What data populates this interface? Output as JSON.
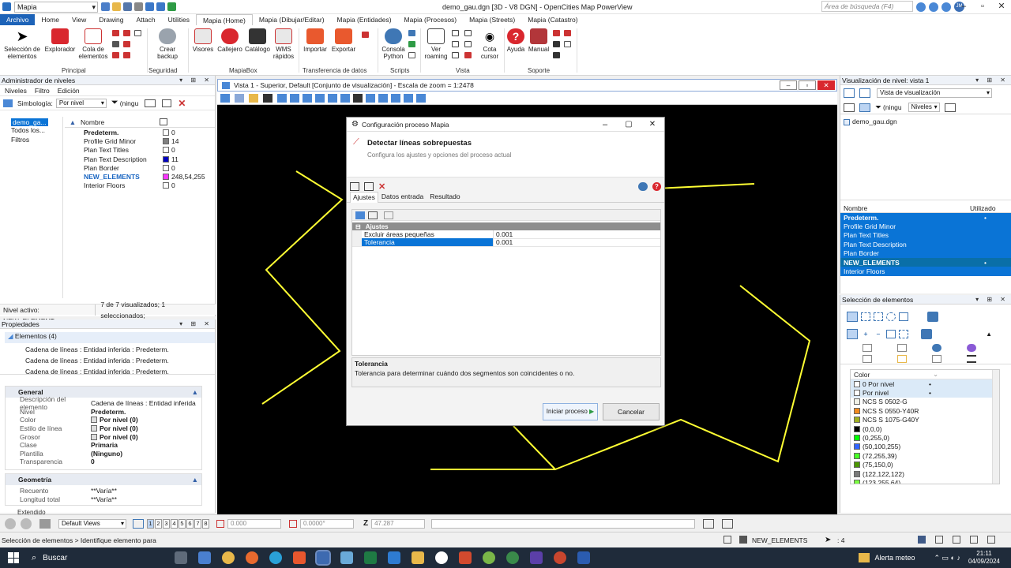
{
  "titlebar": {
    "workspace": "Mapia",
    "title": "demo_gau.dgn [3D - V8 DGN] - OpenCities Map PowerView",
    "search_placeholder": "Área de búsqueda (F4)",
    "user": "JM"
  },
  "tabs": [
    "Archivo",
    "Home",
    "View",
    "Drawing",
    "Attach",
    "Utilities",
    "Mapia (Home)",
    "Mapia (Dibujar/Editar)",
    "Mapia (Entidades)",
    "Mapia (Procesos)",
    "Mapia (Streets)",
    "Mapia (Catastro)"
  ],
  "ribbon": {
    "buttons": {
      "seleccion": "Selección de elementos",
      "explorador": "Explorador",
      "cola": "Cola de elementos",
      "crear_backup": "Crear backup",
      "visores": "Visores",
      "callejero": "Callejero",
      "catalogo": "Catálogo",
      "wms": "WMS rápidos",
      "importar": "Importar",
      "exportar": "Exportar",
      "consola": "Consola Python",
      "ver_roaming": "Ver roaming",
      "cota_cursor": "Cota cursor",
      "ayuda": "Ayuda",
      "manual": "Manual"
    },
    "groups": {
      "principal": "Principal",
      "seguridad": "Seguridad",
      "mapiabox": "MapiaBox",
      "transferencia": "Transferencia de datos",
      "scripts": "Scripts",
      "vista": "Vista",
      "soporte": "Soporte"
    }
  },
  "level_manager": {
    "title": "Administrador de niveles",
    "menu": [
      "Niveles",
      "Filtro",
      "Edición"
    ],
    "symbology_label": "Simbología:",
    "symbology_value": "Por nivel",
    "filter_value": "(ningu",
    "tree": [
      "demo_ga...",
      "Todos los...",
      "Filtros"
    ],
    "col_name": "Nombre",
    "levels": [
      {
        "name": "Predeterm.",
        "val": "0",
        "color": "#ffffff",
        "bold": true
      },
      {
        "name": "Profile Grid Minor",
        "val": "14",
        "color": "#808080",
        "bold": false
      },
      {
        "name": "Plan Text Titles",
        "val": "0",
        "color": "#ffffff",
        "bold": false
      },
      {
        "name": "Plan Text Description",
        "val": "11",
        "color": "#0000c0",
        "bold": false
      },
      {
        "name": "Plan Border",
        "val": "0",
        "color": "#ffffff",
        "bold": false
      },
      {
        "name": "NEW_ELEMENTS",
        "val": "248,54,255",
        "color": "#f836ff",
        "bold": true,
        "accent": true
      },
      {
        "name": "Interior Floors",
        "val": "0",
        "color": "#ffffff",
        "bold": false
      }
    ],
    "status_active": "Nivel activo: NEW_ELEMENT",
    "status_count": "7 de 7 visualizados; 1 seleccionados;"
  },
  "properties": {
    "title": "Propiedades",
    "tree_root": "Elementos (4)",
    "tree_items": [
      "Cadena de líneas : Entidad inferida : Predeterm.",
      "Cadena de líneas : Entidad inferida : Predeterm.",
      "Cadena de líneas : Entidad inferida : Predeterm."
    ],
    "general_title": "General",
    "general_rows": [
      {
        "k": "Descripción del elemento",
        "v": "Cadena de líneas : Entidad inferida"
      },
      {
        "k": "Nivel",
        "v": "Predeterm."
      },
      {
        "k": "Color",
        "v": "Por nivel (0)"
      },
      {
        "k": "Estilo de línea",
        "v": "Por nivel (0)"
      },
      {
        "k": "Grosor",
        "v": "Por nivel (0)"
      },
      {
        "k": "Clase",
        "v": "Primaria"
      },
      {
        "k": "Plantilla",
        "v": "(Ninguno)"
      },
      {
        "k": "Transparencia",
        "v": "0"
      }
    ],
    "geometry_title": "Geometría",
    "geometry_rows": [
      {
        "k": "Recuento",
        "v": "**Varía**"
      },
      {
        "k": "Longitud total",
        "v": "**Varía**"
      }
    ],
    "extended_title": "Extendido"
  },
  "view": {
    "title": "Vista 1 - Superior, Default [Conjunto de visualización] - Escala de zoom = 1:2478"
  },
  "dialog": {
    "title": "Configuración proceso Mapia",
    "heading": "Detectar líneas sobrepuestas",
    "subheading": "Configura los ajustes y opciones del proceso actual",
    "tabs": [
      "Ajustes",
      "Datos entrada",
      "Resultado"
    ],
    "group": "Ajustes",
    "props": [
      {
        "k": "Excluir áreas pequeñas",
        "v": "0.001",
        "selected": false
      },
      {
        "k": "Tolerancia",
        "v": "0.001",
        "selected": true
      }
    ],
    "help_title": "Tolerancia",
    "help_text": "Tolerancia para determinar cuándo dos segmentos son coincidentes o no.",
    "start_button": "Iniciar proceso",
    "cancel_button": "Cancelar"
  },
  "level_display": {
    "title": "Visualización de nivel: vista 1",
    "mode": "Vista de visualización",
    "filter_value": "(ningu",
    "levels_dropdown": "Niveles",
    "file": "demo_gau.dgn",
    "col_name": "Nombre",
    "col_used": "Utilizado",
    "levels": [
      {
        "name": "Predeterm.",
        "used": "•",
        "bold": true
      },
      {
        "name": "Profile Grid Minor",
        "used": "",
        "bold": false
      },
      {
        "name": "Plan Text Titles",
        "used": "",
        "bold": false
      },
      {
        "name": "Plan Text Description",
        "used": "",
        "bold": false
      },
      {
        "name": "Plan Border",
        "used": "",
        "bold": false
      },
      {
        "name": "NEW_ELEMENTS",
        "used": "•",
        "bold": true
      },
      {
        "name": "Interior Floors",
        "used": "",
        "bold": false
      }
    ]
  },
  "element_selection": {
    "title": "Selección de elementos",
    "color_header": "Color",
    "colors": [
      {
        "name": "0 Por nivel",
        "dot": "•",
        "color": "#ffffff",
        "hl": true
      },
      {
        "name": "Por nivel",
        "dot": "•",
        "color": "#ffffff",
        "hl": true
      },
      {
        "name": "NCS S 0502-G",
        "dot": "",
        "color": "#f2f2e8",
        "hl": false
      },
      {
        "name": "NCS S 0550-Y40R",
        "dot": "",
        "color": "#f28a1e",
        "hl": false
      },
      {
        "name": "NCS S 1075-G40Y",
        "dot": "",
        "color": "#a0b020",
        "hl": false
      },
      {
        "name": "(0,0,0)",
        "dot": "",
        "color": "#000000",
        "hl": false
      },
      {
        "name": "(0,255,0)",
        "dot": "",
        "color": "#00ff00",
        "hl": false
      },
      {
        "name": "(50,100,255)",
        "dot": "",
        "color": "#3264ff",
        "hl": false
      },
      {
        "name": "(72,255,39)",
        "dot": "",
        "color": "#48ff27",
        "hl": false
      },
      {
        "name": "(75,150,0)",
        "dot": "",
        "color": "#4b9600",
        "hl": false
      },
      {
        "name": "(122,122,122)",
        "dot": "",
        "color": "#7a7a7a",
        "hl": false
      },
      {
        "name": "(123,255,64)",
        "dot": "",
        "color": "#7bff40",
        "hl": false
      }
    ]
  },
  "bottom": {
    "views": "Default Views",
    "view_numbers": [
      "1",
      "2",
      "3",
      "4",
      "5",
      "6",
      "7",
      "8"
    ],
    "x": "0.000",
    "angle": "0.0000°",
    "z_label": "Z",
    "z": "47.287",
    "status": "Selección de elementos > Identifique elemento para",
    "active_level": "NEW_ELEMENTS",
    "count": ": 4"
  },
  "taskbar": {
    "search": "Buscar",
    "weather": "Alerta meteo",
    "time": "21:11",
    "date": "04/09/2024"
  }
}
